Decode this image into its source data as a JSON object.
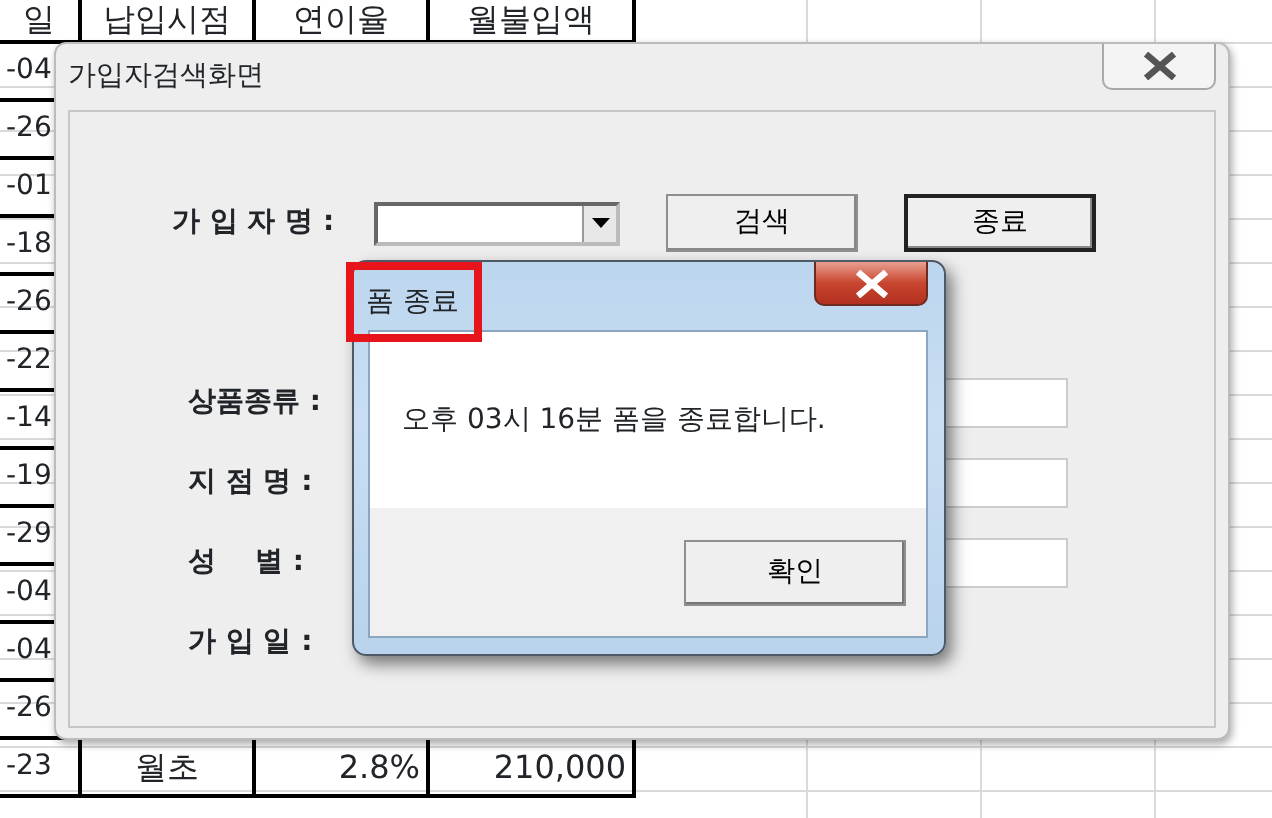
{
  "sheet": {
    "headers": [
      "일",
      "납입시점",
      "연이율",
      "월불입액"
    ],
    "rows": [
      {
        "cells": [
          "-04"
        ]
      },
      {
        "cells": [
          "-26"
        ]
      },
      {
        "cells": [
          "-01"
        ]
      },
      {
        "cells": [
          "-18"
        ]
      },
      {
        "cells": [
          "-26"
        ]
      },
      {
        "cells": [
          "-22"
        ]
      },
      {
        "cells": [
          "-14"
        ]
      },
      {
        "cells": [
          "-19"
        ]
      },
      {
        "cells": [
          "-29"
        ]
      },
      {
        "cells": [
          "-04"
        ]
      },
      {
        "cells": [
          "-04"
        ]
      },
      {
        "cells": [
          "-26"
        ]
      },
      {
        "cells": [
          "-23",
          "월초",
          "2.8%",
          "210,000"
        ]
      }
    ]
  },
  "form": {
    "title": "가입자검색화면",
    "name_label": "가 입 자 명 :",
    "buttons": [
      {
        "label": "검색",
        "default": false
      },
      {
        "label": "종료",
        "default": true
      }
    ],
    "fields": [
      {
        "label": "상품종류 :",
        "has_box": true
      },
      {
        "label": "지 점 명 :",
        "has_box": true
      },
      {
        "label": "성    별 :",
        "has_box": true
      },
      {
        "label": "가 입 일 :",
        "has_box": false
      }
    ]
  },
  "dialog": {
    "title": "폼 종료",
    "title_marked": true,
    "message": "오후 03시 16분 폼을 종료합니다.",
    "button": "확인"
  }
}
